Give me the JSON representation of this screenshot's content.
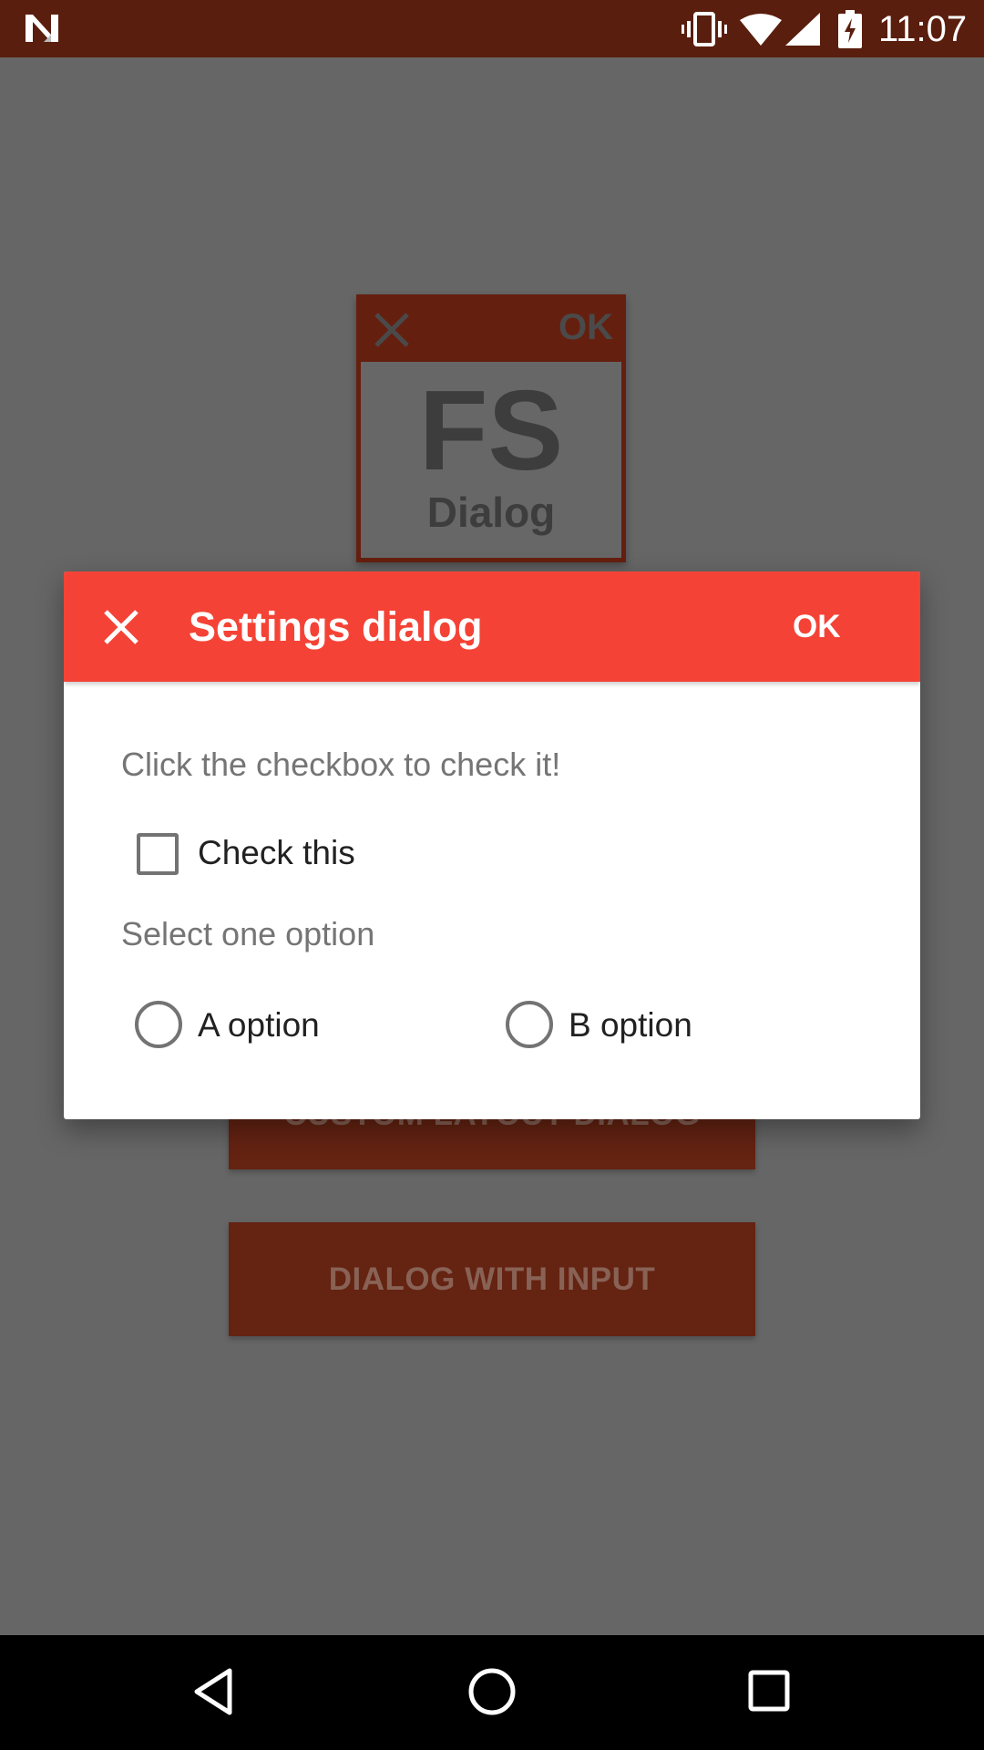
{
  "status_bar": {
    "time": "11:07",
    "icons": [
      "n-logo-icon",
      "vibrate-icon",
      "wifi-icon",
      "cell-signal-icon",
      "battery-charging-icon"
    ]
  },
  "background": {
    "logo": {
      "ok_label": "OK",
      "title": "FS",
      "subtitle": "Dialog"
    },
    "buttons": [
      {
        "label": "CUSTOM LAYOUT DIALOG"
      },
      {
        "label": "DIALOG WITH INPUT"
      }
    ]
  },
  "dialog": {
    "title": "Settings dialog",
    "ok_label": "OK",
    "close_icon": "close-icon",
    "prompt": "Click the checkbox to check it!",
    "checkbox": {
      "label": "Check this",
      "checked": false
    },
    "radio_section_label": "Select one option",
    "radio_options": [
      {
        "label": "A option",
        "selected": false
      },
      {
        "label": "B option",
        "selected": false
      }
    ],
    "toolbar_color": "#f44336"
  },
  "nav_bar": {
    "icons": [
      "back-icon",
      "home-icon",
      "recents-icon"
    ]
  }
}
